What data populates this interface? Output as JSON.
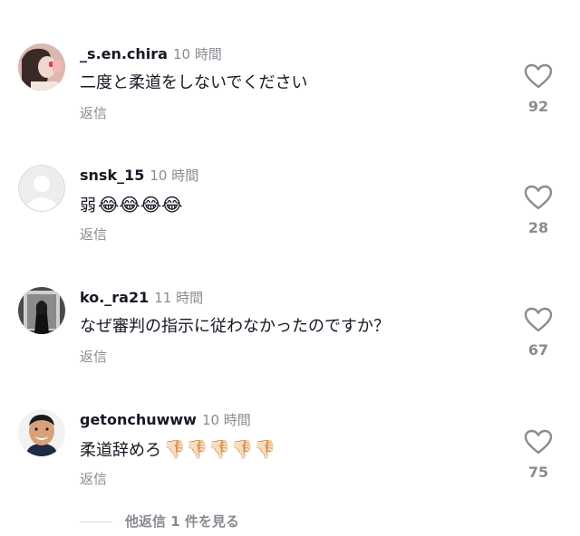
{
  "comments": [
    {
      "username": "_s.en.chira",
      "time": "10 時間",
      "text": "二度と柔道をしないでください",
      "emoji": "",
      "reply_label": "返信",
      "likes": "92"
    },
    {
      "username": "snsk_15",
      "time": "10 時間",
      "text": "弱",
      "emoji": "😂😂😂😂",
      "reply_label": "返信",
      "likes": "28"
    },
    {
      "username": "ko._ra21",
      "time": "11 時間",
      "text": "なぜ審判の指示に従わなかったのですか？",
      "emoji": "",
      "reply_label": "返信",
      "likes": "67"
    },
    {
      "username": "getonchuwww",
      "time": "10 時間",
      "text": "柔道辞めろ",
      "emoji": "👎🏻👎🏻👎🏻👎🏻👎🏻",
      "reply_label": "返信",
      "likes": "75"
    }
  ],
  "more_replies_label": "他返信 1 件を見る",
  "colors": {
    "primary_text": "#161823",
    "secondary_text": "#8a8b91",
    "background": "#ffffff"
  }
}
